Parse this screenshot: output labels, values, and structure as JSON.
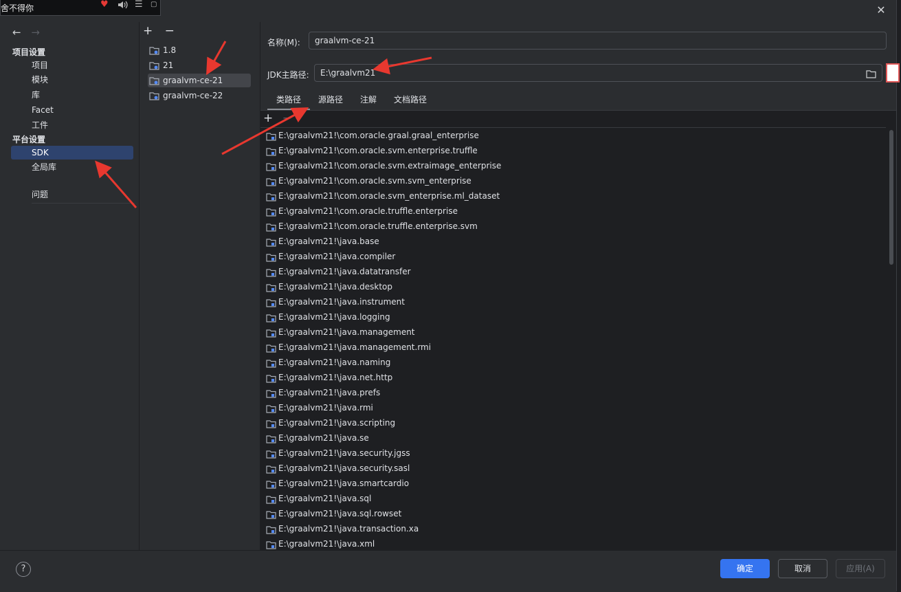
{
  "music_player": {
    "song": "舍不得你"
  },
  "nav": {
    "back_icon": "←",
    "forward_icon": "→",
    "project_section": "项目设置",
    "project_items": [
      "项目",
      "模块",
      "库",
      "Facet",
      "工件"
    ],
    "platform_section": "平台设置",
    "platform_items": [
      "SDK",
      "全局库"
    ],
    "problems": "问题"
  },
  "sdk_list": {
    "add": "+",
    "remove": "−",
    "items": [
      "1.8",
      "21",
      "graalvm-ce-21",
      "graalvm-ce-22"
    ],
    "selected": "graalvm-ce-21"
  },
  "detail": {
    "name_label": "名称(M):",
    "name_value": "graalvm-ce-21",
    "home_label": "JDK主路径:",
    "home_value": "E:\\graalvm21",
    "tabs": [
      "类路径",
      "源路径",
      "注解",
      "文档路径"
    ],
    "selected_tab": "类路径",
    "classpath": [
      "E:\\graalvm21!\\com.oracle.graal.graal_enterprise",
      "E:\\graalvm21!\\com.oracle.svm.enterprise.truffle",
      "E:\\graalvm21!\\com.oracle.svm.extraimage_enterprise",
      "E:\\graalvm21!\\com.oracle.svm.svm_enterprise",
      "E:\\graalvm21!\\com.oracle.svm_enterprise.ml_dataset",
      "E:\\graalvm21!\\com.oracle.truffle.enterprise",
      "E:\\graalvm21!\\com.oracle.truffle.enterprise.svm",
      "E:\\graalvm21!\\java.base",
      "E:\\graalvm21!\\java.compiler",
      "E:\\graalvm21!\\java.datatransfer",
      "E:\\graalvm21!\\java.desktop",
      "E:\\graalvm21!\\java.instrument",
      "E:\\graalvm21!\\java.logging",
      "E:\\graalvm21!\\java.management",
      "E:\\graalvm21!\\java.management.rmi",
      "E:\\graalvm21!\\java.naming",
      "E:\\graalvm21!\\java.net.http",
      "E:\\graalvm21!\\java.prefs",
      "E:\\graalvm21!\\java.rmi",
      "E:\\graalvm21!\\java.scripting",
      "E:\\graalvm21!\\java.se",
      "E:\\graalvm21!\\java.security.jgss",
      "E:\\graalvm21!\\java.security.sasl",
      "E:\\graalvm21!\\java.smartcardio",
      "E:\\graalvm21!\\java.sql",
      "E:\\graalvm21!\\java.sql.rowset",
      "E:\\graalvm21!\\java.transaction.xa",
      "E:\\graalvm21!\\java.xml"
    ]
  },
  "footer": {
    "help": "?",
    "ok": "确定",
    "cancel": "取消",
    "apply": "应用(A)"
  },
  "colors": {
    "accent": "#3574f0",
    "selection": "#2e436e",
    "arrow": "#e8382f"
  }
}
